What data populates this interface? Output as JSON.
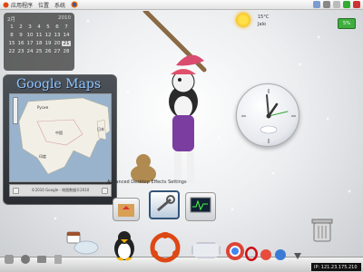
{
  "top_panel": {
    "menu": [
      "应用程序",
      "位置",
      "系统"
    ],
    "clock": "2010/..."
  },
  "calendar": {
    "month": "2月",
    "year": "2010",
    "rows": [
      [
        "1",
        "2",
        "3",
        "4",
        "5",
        "6",
        "7"
      ],
      [
        "8",
        "9",
        "10",
        "11",
        "12",
        "13",
        "14"
      ],
      [
        "15",
        "16",
        "17",
        "18",
        "19",
        "20",
        "21"
      ],
      [
        "22",
        "23",
        "24",
        "25",
        "26",
        "27",
        "28"
      ]
    ],
    "today": "21"
  },
  "maps": {
    "title": "Google Maps",
    "labels": [
      {
        "text": "Русия"
      },
      {
        "text": "中国"
      },
      {
        "text": "日本"
      },
      {
        "text": "印度"
      }
    ],
    "copyright": "©2010 Google - 地图数据©2010"
  },
  "weather": {
    "temp": "15°C",
    "city": "Jalo",
    "extra": "~15°"
  },
  "cpu": {
    "label": "5%"
  },
  "switcher": {
    "label": "Advanced Desktop Effects Settings"
  },
  "ip": {
    "text": "IP: 121.23.175.210"
  },
  "colors": {
    "accent": "#8fc7ff",
    "cpu": "#3fae3f",
    "sun": "#ffe14a"
  },
  "icons": {
    "dock": [
      "cup-icon",
      "home-icon",
      "tux-icon",
      "ubuntu-icon",
      "music-icon",
      "chrome-icon",
      "opera-icon",
      "tomato-icon",
      "globe-icon"
    ],
    "tray": [
      "network-icon",
      "volume-icon",
      "user-icon",
      "battery-icon",
      "power-icon"
    ]
  }
}
